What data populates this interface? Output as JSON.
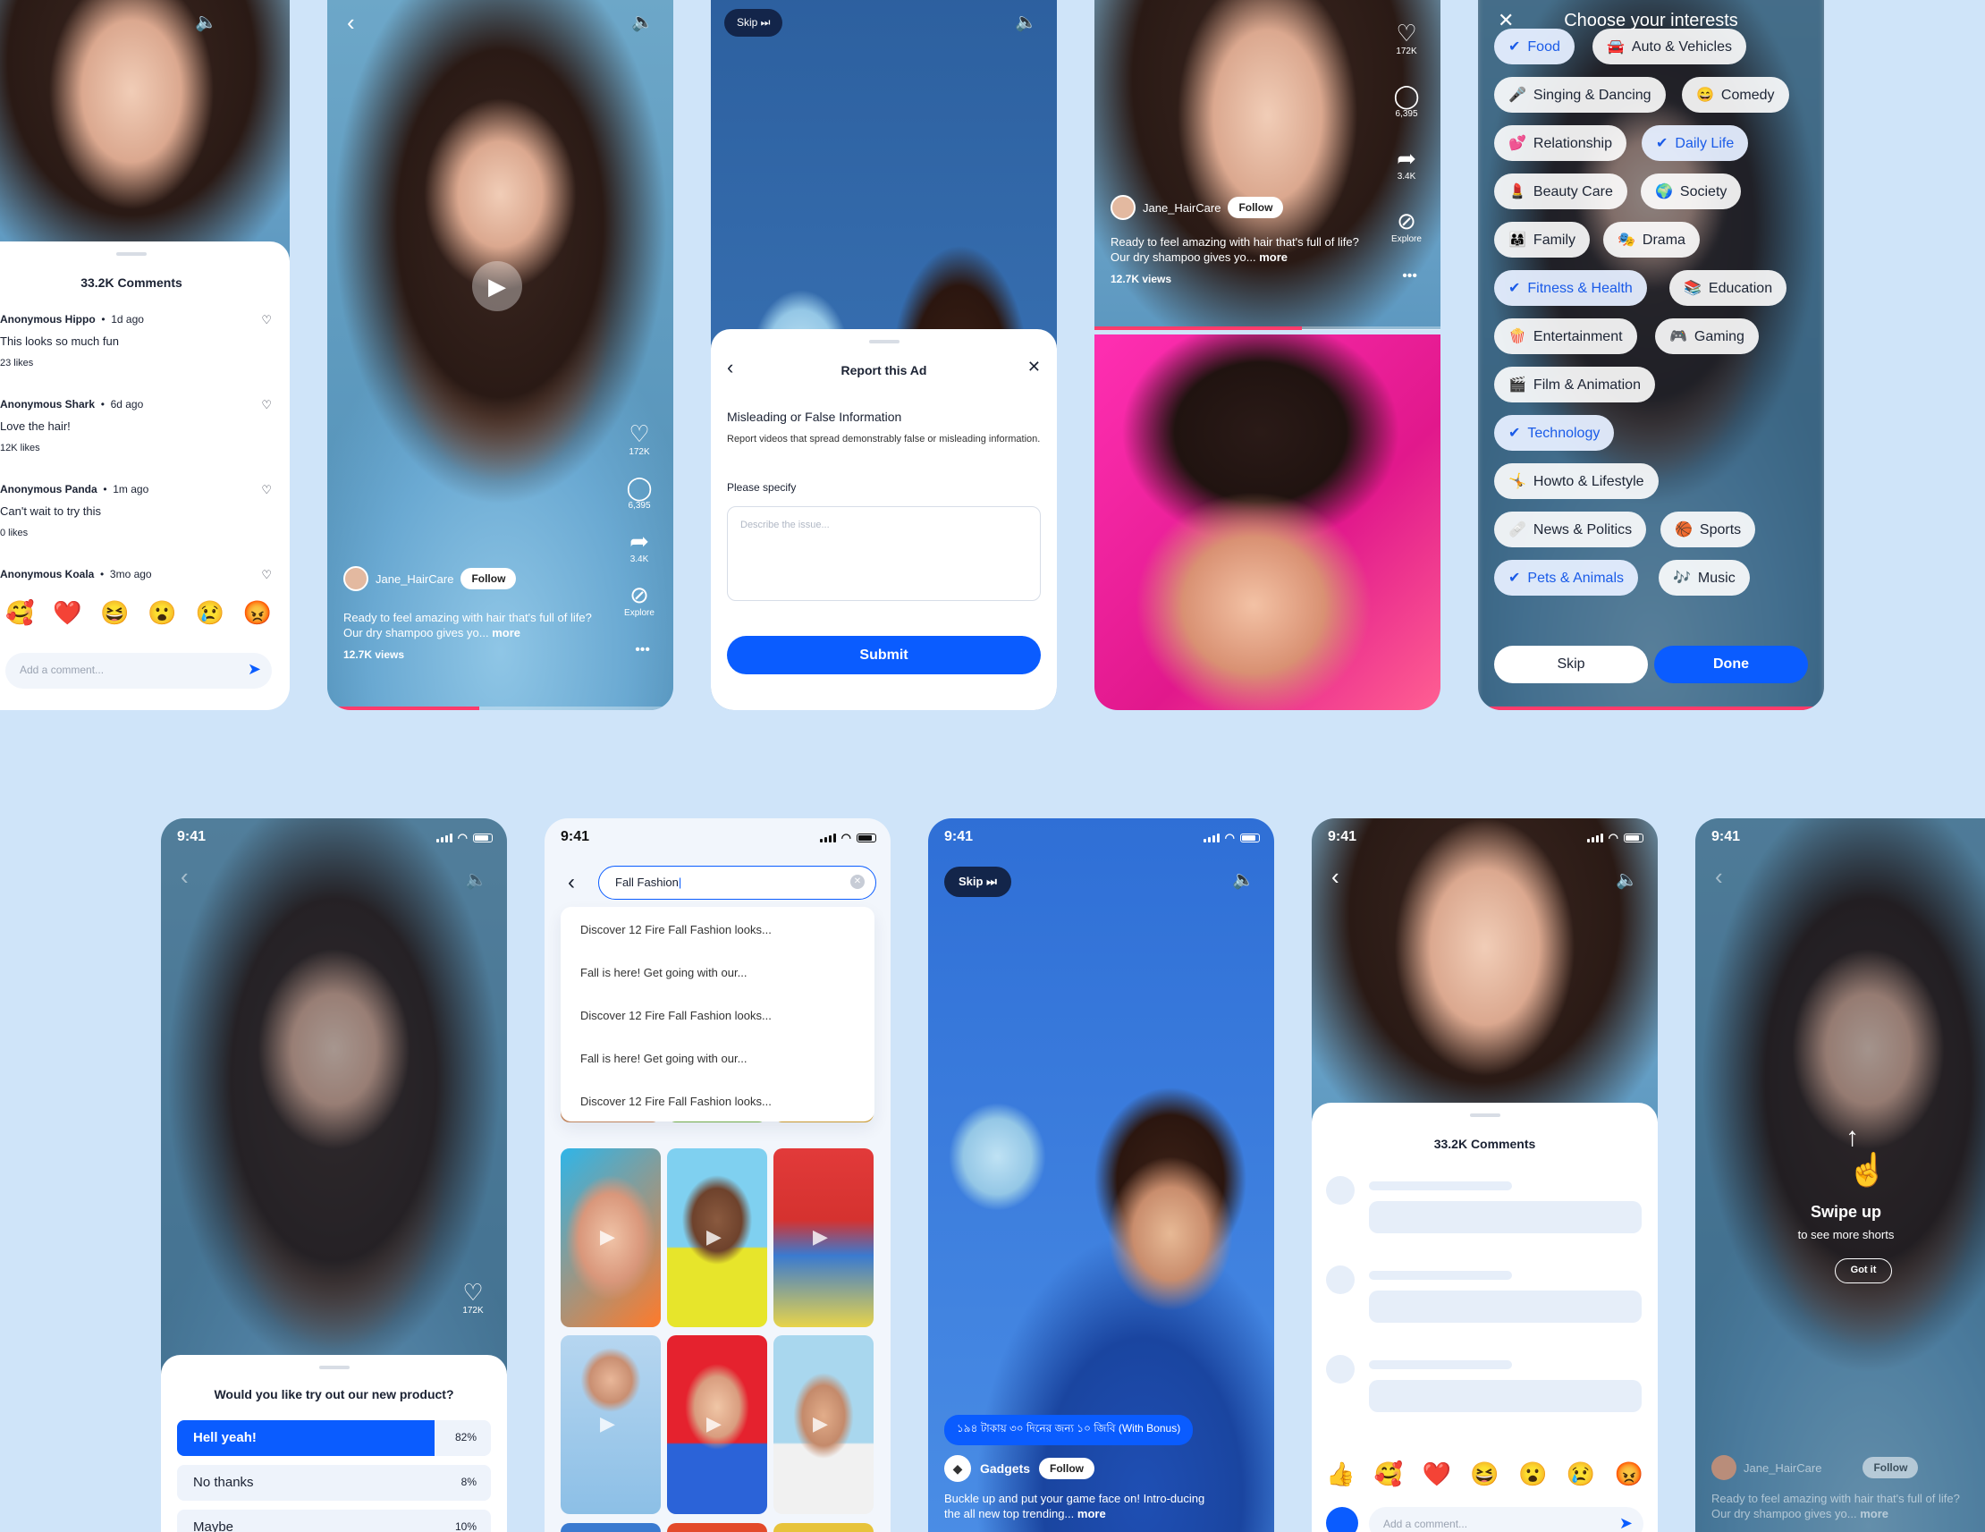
{
  "colors": {
    "accent": "#0a5cff",
    "background": "#cfe4f9",
    "progress": "#ff3b6b"
  },
  "comments_sheet": {
    "title": "33.2K Comments",
    "comments": [
      {
        "user": "Anonymous Hippo",
        "time": "1d ago",
        "text": "This looks so much fun",
        "likes": "23 likes"
      },
      {
        "user": "Anonymous Shark",
        "time": "6d ago",
        "text": "Love the hair!",
        "likes": "12K likes"
      },
      {
        "user": "Anonymous Panda",
        "time": "1m ago",
        "text": "Can't wait to try this",
        "likes": "0 likes"
      },
      {
        "user": "Anonymous Koala",
        "time": "3mo ago",
        "text": "",
        "likes": ""
      }
    ],
    "reactions": [
      "🥰",
      "❤️",
      "😆",
      "😮",
      "😢",
      "😡"
    ],
    "input_placeholder": "Add a comment..."
  },
  "video": {
    "username": "Jane_HairCare",
    "follow": "Follow",
    "caption": "Ready to feel amazing      with hair that's full of life? Our dry shampoo gives yo...",
    "more": "more",
    "views": "12.7K views",
    "likes": "172K",
    "comments": "6,395",
    "shares": "3.4K",
    "explore": "Explore"
  },
  "report": {
    "skip": "Skip",
    "title": "Report this Ad",
    "reason": "Misleading or False Information",
    "description": "Report videos that spread demonstrably false or misleading information.",
    "specify_label": "Please specify",
    "placeholder": "Describe the issue...",
    "submit": "Submit"
  },
  "interests": {
    "title": "Choose your interests",
    "items": [
      {
        "emoji": "✔",
        "label": "Food"
      },
      {
        "emoji": "🚘",
        "label": "Auto & Vehicles"
      },
      {
        "emoji": "🎤",
        "label": "Singing & Dancing"
      },
      {
        "emoji": "😄",
        "label": "Comedy"
      },
      {
        "emoji": "💕",
        "label": "Relationship"
      },
      {
        "emoji": "✔",
        "label": "Daily Life"
      },
      {
        "emoji": "💄",
        "label": "Beauty Care"
      },
      {
        "emoji": "🌍",
        "label": "Society"
      },
      {
        "emoji": "👨‍👩‍👧",
        "label": "Family"
      },
      {
        "emoji": "🎭",
        "label": "Drama"
      },
      {
        "emoji": "✔",
        "label": "Fitness & Health"
      },
      {
        "emoji": "📚",
        "label": "Education"
      },
      {
        "emoji": "🍿",
        "label": "Entertainment"
      },
      {
        "emoji": "🎮",
        "label": "Gaming"
      },
      {
        "emoji": "🎬",
        "label": "Film & Animation"
      },
      {
        "emoji": "✔",
        "label": "Technology"
      },
      {
        "emoji": "🤸",
        "label": "Howto & Lifestyle"
      },
      {
        "emoji": "🩹",
        "label": "News & Politics"
      },
      {
        "emoji": "🏀",
        "label": "Sports"
      },
      {
        "emoji": "✔",
        "label": "Pets & Animals"
      },
      {
        "emoji": "🎶",
        "label": "Music"
      }
    ],
    "skip": "Skip",
    "done": "Done"
  },
  "status": {
    "time": "9:41"
  },
  "poll": {
    "likes": "172K",
    "question": "Would you like try out our new product?",
    "options": [
      {
        "label": "Hell yeah!",
        "pct": "82%",
        "value": 0.82
      },
      {
        "label": "No thanks",
        "pct": "8%",
        "value": 0.08
      },
      {
        "label": "Maybe",
        "pct": "10%",
        "value": 0.1
      }
    ]
  },
  "search": {
    "query": "Fall Fashion",
    "suggestions": [
      "Discover 12 Fire Fall Fashion looks...",
      "Fall is here! Get going with our...",
      "Discover 12 Fire Fall Fashion looks...",
      "Fall is here! Get going with our...",
      "Discover 12 Fire Fall Fashion looks..."
    ]
  },
  "ad": {
    "skip": "Skip",
    "offer": "১৯৪ টাকায় ৩০ দিনের জন্য ১০ জিবি (With Bonus)",
    "brand": "Gadgets",
    "follow": "Follow",
    "caption": "Buckle up and put your game face on! Intro-ducing the all new top trending...",
    "more": "more"
  },
  "loading": {
    "title": "33.2K Comments",
    "reactions": [
      "👍",
      "🥰",
      "❤️",
      "😆",
      "😮",
      "😢",
      "😡"
    ],
    "placeholder": "Add a comment..."
  },
  "onboard": {
    "title": "Swipe up",
    "subtitle": "to see more shorts",
    "button": "Got it",
    "username": "Jane_HairCare",
    "follow": "Follow",
    "caption": "Ready to feel amazing      with hair that's full of life? Our dry shampoo gives yo...",
    "more": "more"
  }
}
